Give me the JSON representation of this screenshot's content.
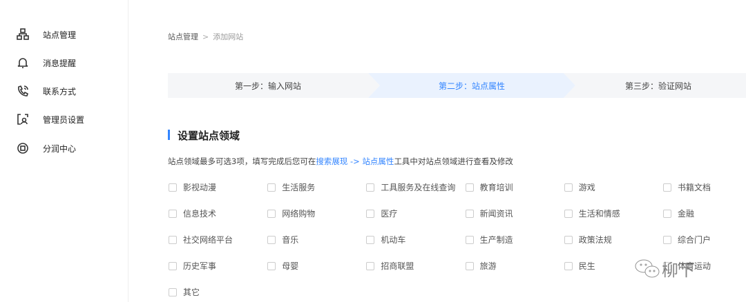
{
  "sidebar": {
    "items": [
      {
        "label": "站点管理",
        "icon": "sitemap-icon"
      },
      {
        "label": "消息提醒",
        "icon": "bell-icon"
      },
      {
        "label": "联系方式",
        "icon": "phone-icon"
      },
      {
        "label": "管理员设置",
        "icon": "admin-icon"
      },
      {
        "label": "分润中心",
        "icon": "revenue-icon"
      }
    ]
  },
  "breadcrumb": {
    "root": "站点管理",
    "sep": ">",
    "current": "添加网站"
  },
  "steps": [
    {
      "label": "第一步：输入网站"
    },
    {
      "label": "第二步：站点属性"
    },
    {
      "label": "第三步：验证网站"
    }
  ],
  "colors": {
    "accent": "#3385ff",
    "active_step_bg": "#eaf2fe",
    "step_bg": "#f5f6f8"
  },
  "section": {
    "title": "设置站点领域",
    "desc_pre": "站点领域最多可选3项，填写完成后您可在",
    "link1": "搜索展现",
    "arrow": " -> ",
    "link2": "站点属性",
    "desc_post": "工具中对站点领域进行查看及修改"
  },
  "options": [
    "影视动漫",
    "生活服务",
    "工具服务及在线查询",
    "教育培训",
    "游戏",
    "书籍文档",
    "信息技术",
    "网络购物",
    "医疗",
    "新闻资讯",
    "生活和情感",
    "金融",
    "社交网络平台",
    "音乐",
    "机动车",
    "生产制造",
    "政策法规",
    "综合门户",
    "历史军事",
    "母婴",
    "招商联盟",
    "旅游",
    "民生",
    "体育运动",
    "其它"
  ],
  "watermark": "柳下"
}
